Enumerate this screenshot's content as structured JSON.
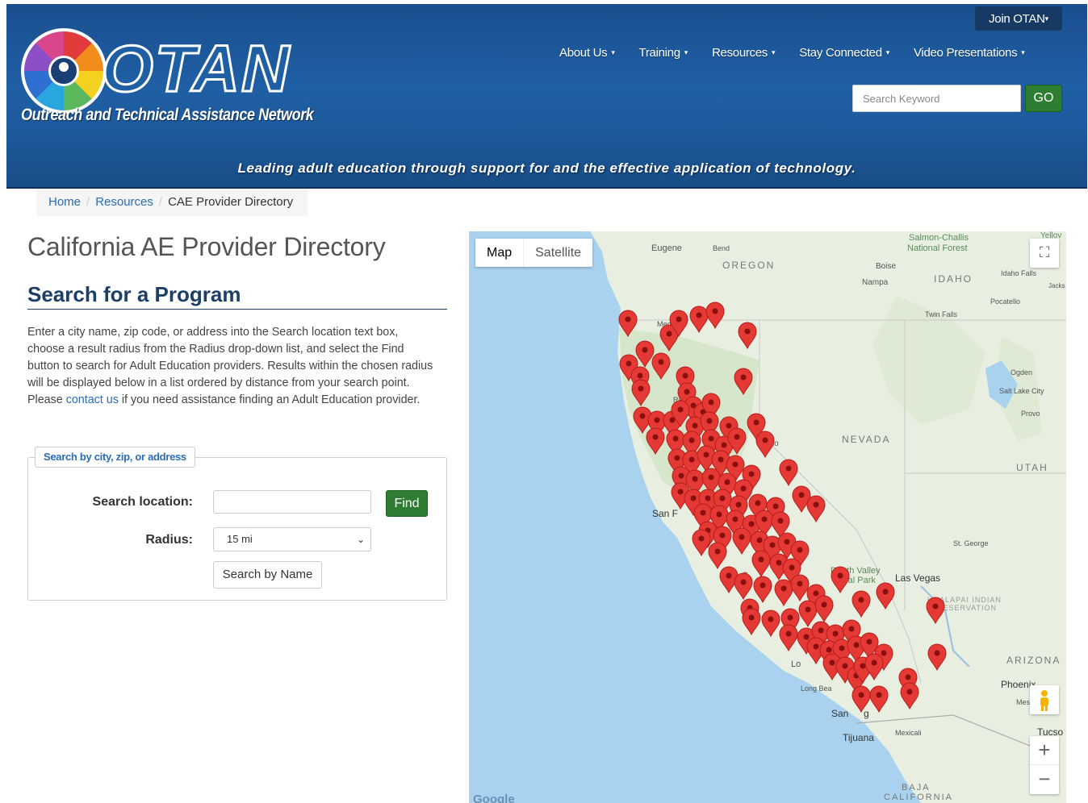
{
  "header": {
    "logo_word": "OTAN",
    "logo_tagline": "Outreach and Technical Assistance Network",
    "join_label": "Join OTAN",
    "nav": [
      "About Us",
      "Training",
      "Resources",
      "Stay Connected",
      "Video Presentations"
    ],
    "search_placeholder": "Search Keyword",
    "go_label": "GO",
    "tagline": "Leading adult education through support for and the effective application of technology."
  },
  "breadcrumb": {
    "home": "Home",
    "resources": "Resources",
    "current": "CAE Provider Directory"
  },
  "main": {
    "page_title": "California AE Provider Directory",
    "section_title": "Search for a Program",
    "intro_before": "Enter a city name, zip code, or address into the Search location text box, choose a result radius from the Radius drop-down list, and select the Find button to search for Adult Education providers. Results within the chosen radius will be displayed below in a list ordered by distance from your search point. Please ",
    "intro_link": "contact us",
    "intro_after": " if you need assistance finding an Adult Education provider."
  },
  "form": {
    "legend": "Search by city, zip, or address",
    "location_label": "Search location:",
    "location_value": "",
    "find_label": "Find",
    "radius_label": "Radius:",
    "radius_value": "15 mi",
    "byname_label": "Search by Name"
  },
  "map": {
    "type_map": "Map",
    "type_satellite": "Satellite",
    "zoom_in": "+",
    "zoom_out": "−",
    "attribution": "Google",
    "pin_color": "#e53935",
    "labels": {
      "eugene": "Eugene",
      "bend": "Bend",
      "oregon": "OREGON",
      "boise": "Boise",
      "nampa": "Nampa",
      "idaho": "IDAHO",
      "idaho_falls": "Idaho Falls",
      "salmon": "Salmon-Challis",
      "salmon2": "National Forest",
      "pocatello": "Pocatello",
      "twin_falls": "Twin Falls",
      "medford": "Medford",
      "ogden": "Ogden",
      "slc": "Salt Lake City",
      "provo": "Provo",
      "nevada": "NEVADA",
      "utah": "UTAH",
      "reno": "eno",
      "sanf": "San F",
      "st_george": "St. George",
      "death_valley": "Death Valley",
      "death_valley2": "ional Park",
      "las_vegas": "Las Vegas",
      "hualapai": "HUALAPAI INDIAN",
      "hualapai2": "RESERVATION",
      "arizona": "ARIZONA",
      "phoenix": "Phoenix",
      "long_beach": "Long Bea",
      "san_diego": "San",
      "tijuana": "Tijuana",
      "mexicali": "Mexicali",
      "tucson": "Tucso",
      "baja": "BAJA",
      "baja2": "CALIFORNIA",
      "yellow": "Yellov",
      "re": "Re",
      "c": "C",
      "lo": "Lo",
      "mes": "Mes",
      "jacks": "Jacks",
      "dg": "g"
    }
  }
}
